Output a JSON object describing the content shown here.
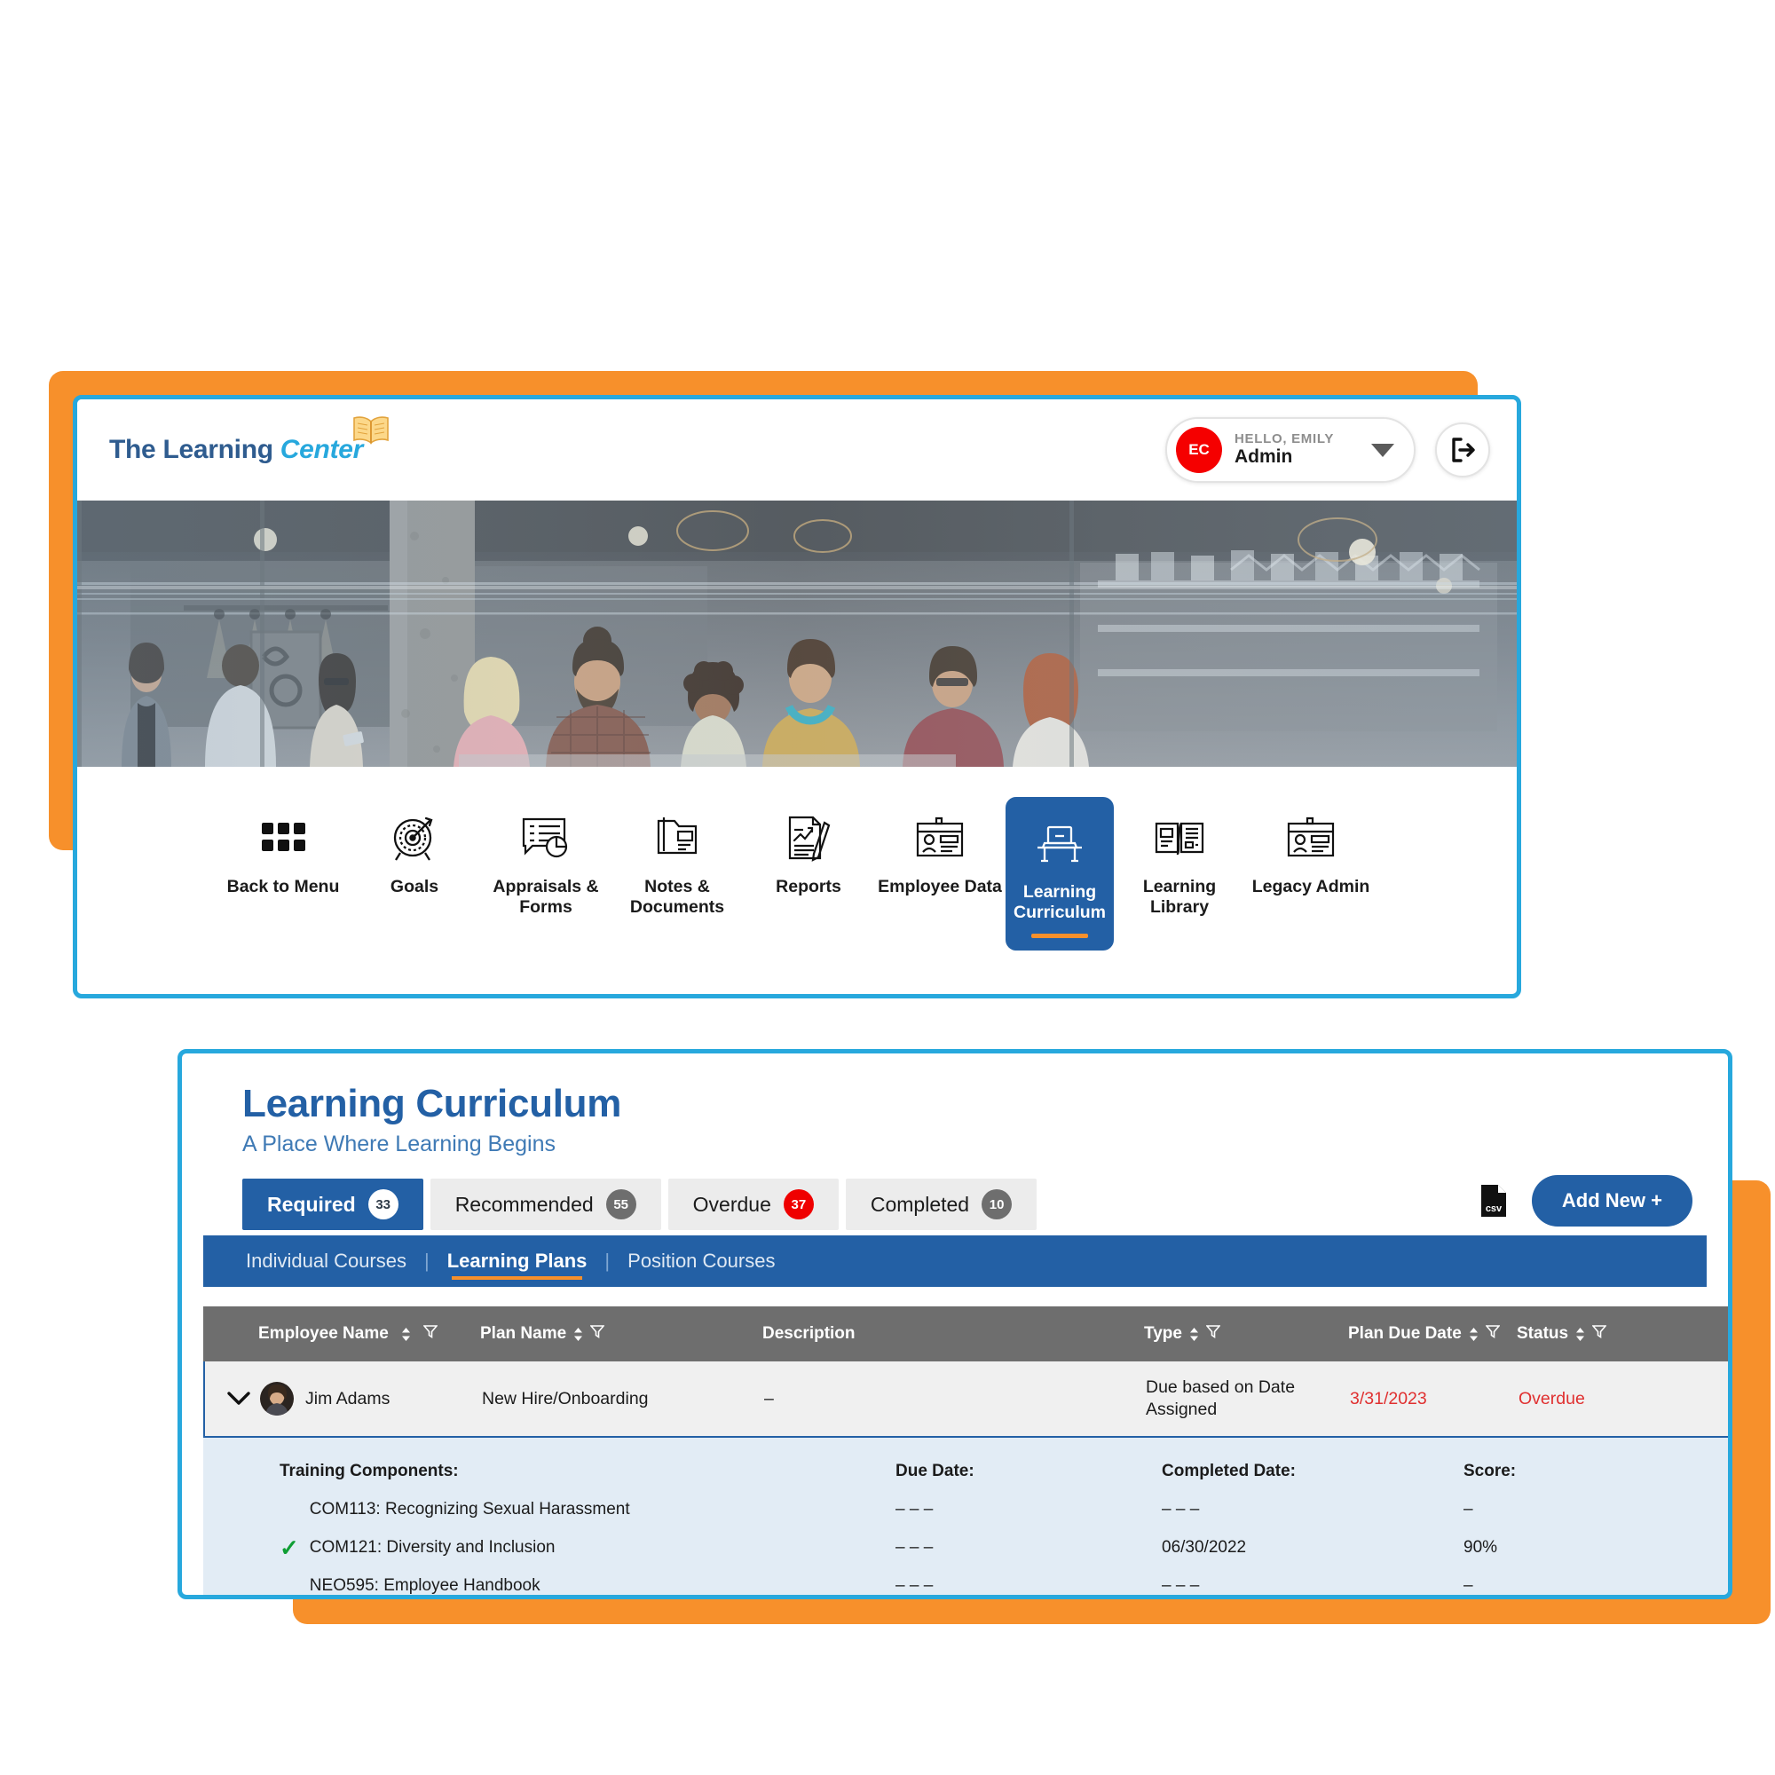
{
  "brand": {
    "logo_the": "The Learning",
    "logo_center": "Center",
    "book_icon": "open-book-icon"
  },
  "header": {
    "hello_label": "HELLO, EMILY",
    "user_role": "Admin",
    "avatar_initials": "EC",
    "dropdown_icon": "chevron-down-icon",
    "logout_icon": "logout-icon",
    "accent_blue": "#27a8dd",
    "accent_orange": "#f7902b",
    "brand_blue": "#2360a5"
  },
  "nav": {
    "items": [
      {
        "label": "Back to Menu",
        "icon": "grid-menu-icon",
        "active": false
      },
      {
        "label": "Goals",
        "icon": "target-icon",
        "active": false
      },
      {
        "label": "Appraisals & Forms",
        "icon": "form-chart-icon",
        "active": false
      },
      {
        "label": "Notes & Documents",
        "icon": "folder-document-icon",
        "active": false
      },
      {
        "label": "Reports",
        "icon": "report-pen-icon",
        "active": false
      },
      {
        "label": "Employee Data",
        "icon": "id-badge-icon",
        "active": false
      },
      {
        "label": "Learning Curriculum",
        "icon": "laptop-desk-icon",
        "active": true
      },
      {
        "label": "Learning Library",
        "icon": "open-book-pages-icon",
        "active": false
      },
      {
        "label": "Legacy Admin",
        "icon": "id-badge-icon",
        "active": false
      }
    ]
  },
  "main": {
    "title": "Learning Curriculum",
    "subtitle": "A Place Where Learning Begins",
    "tabs": [
      {
        "label": "Required",
        "count": "33",
        "active": true,
        "badge_style": "white"
      },
      {
        "label": "Recommended",
        "count": "55",
        "active": false,
        "badge_style": "grey"
      },
      {
        "label": "Overdue",
        "count": "37",
        "active": false,
        "badge_style": "red"
      },
      {
        "label": "Completed",
        "count": "10",
        "active": false,
        "badge_style": "grey"
      }
    ],
    "tools": {
      "csv_icon": "csv-file-icon",
      "csv_label": "csv",
      "add_new_label": "Add New +"
    },
    "subnav": {
      "items": [
        {
          "label": "Individual Courses",
          "active": false
        },
        {
          "label": "Learning Plans",
          "active": true
        },
        {
          "label": "Position Courses",
          "active": false
        }
      ],
      "separator": "|"
    },
    "table": {
      "columns": [
        {
          "label": "Employee Name",
          "sortable": true,
          "filterable": true
        },
        {
          "label": "Plan Name",
          "sortable": true,
          "filterable": true
        },
        {
          "label": "Description",
          "sortable": false,
          "filterable": false
        },
        {
          "label": "Type",
          "sortable": true,
          "filterable": true
        },
        {
          "label": "Plan Due Date",
          "sortable": true,
          "filterable": true
        },
        {
          "label": "Status",
          "sortable": true,
          "filterable": true
        }
      ],
      "rows": [
        {
          "expanded": true,
          "expand_icon": "chevron-down-icon",
          "avatar": "employee-photo",
          "employee_name": "Jim Adams",
          "plan_name": "New Hire/Onboarding",
          "description": "–",
          "type": "Due based on Date Assigned",
          "plan_due_date": "3/31/2023",
          "status": "Overdue",
          "status_color": "#e03030"
        }
      ],
      "detail": {
        "headers": {
          "components": "Training Components:",
          "due_date": "Due Date:",
          "completed_date": "Completed Date:",
          "score": "Score:"
        },
        "components": [
          {
            "completed": false,
            "name": "COM113: Recognizing Sexual Harassment",
            "due_date": "– – –",
            "completed_date": "– – –",
            "score": "–"
          },
          {
            "completed": true,
            "name": "COM121: Diversity and Inclusion",
            "due_date": "– – –",
            "completed_date": "06/30/2022",
            "score": "90%"
          },
          {
            "completed": false,
            "name": "NEO595: Employee Handbook",
            "due_date": "– – –",
            "completed_date": "– – –",
            "score": "–"
          }
        ]
      }
    }
  }
}
